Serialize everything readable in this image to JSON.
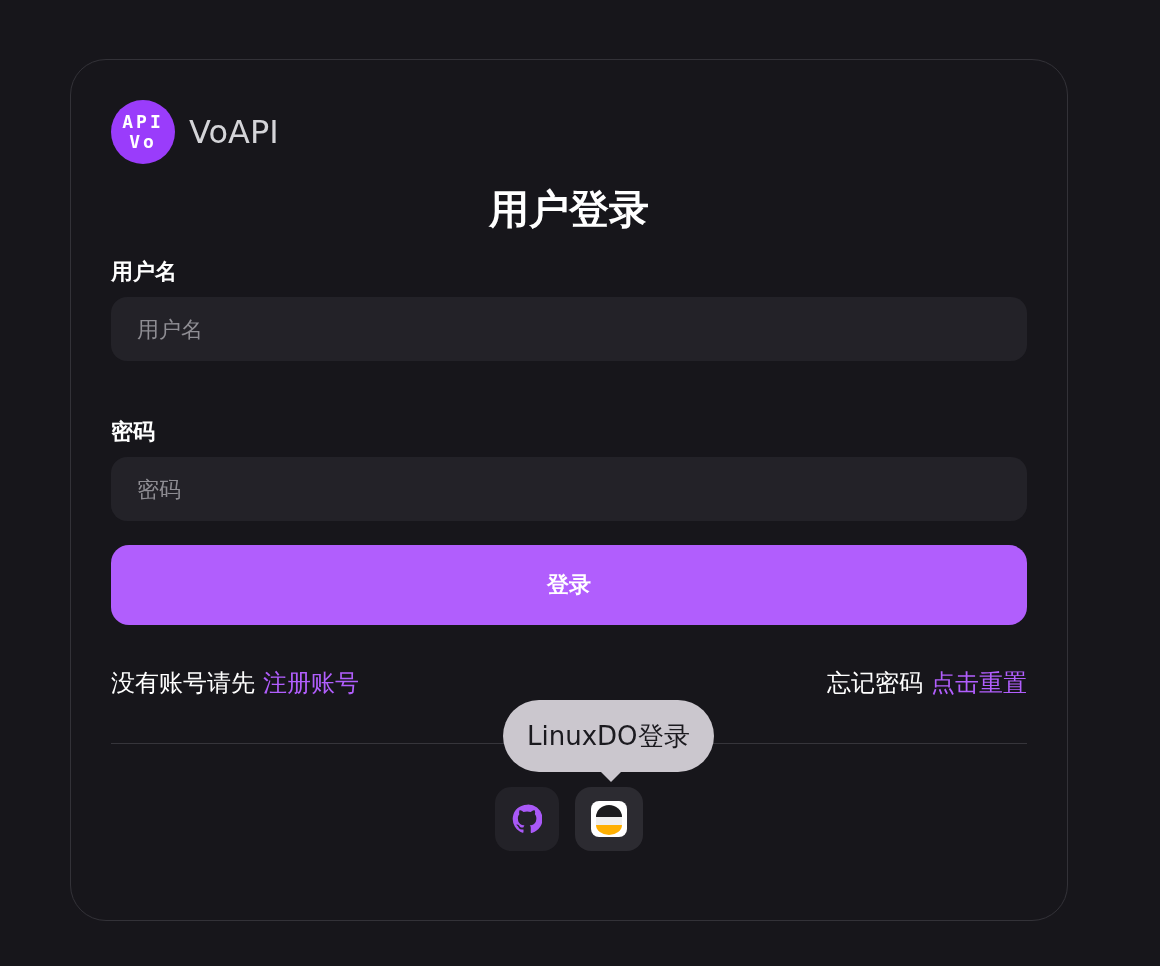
{
  "brand": {
    "logo_lines": [
      "API",
      "Vo"
    ],
    "name": "VoAPI"
  },
  "title": "用户登录",
  "fields": [
    {
      "label": "用户名",
      "placeholder": "用户名"
    },
    {
      "label": "密码",
      "placeholder": "密码"
    }
  ],
  "submit": "登录",
  "links": [
    {
      "text": "没有账号请先",
      "link": "注册账号"
    },
    {
      "text": "忘记密码",
      "link": "点击重置"
    }
  ],
  "tooltip": "LinuxDO登录",
  "social": [
    {
      "kind": "github"
    },
    {
      "kind": "linuxdo"
    }
  ]
}
